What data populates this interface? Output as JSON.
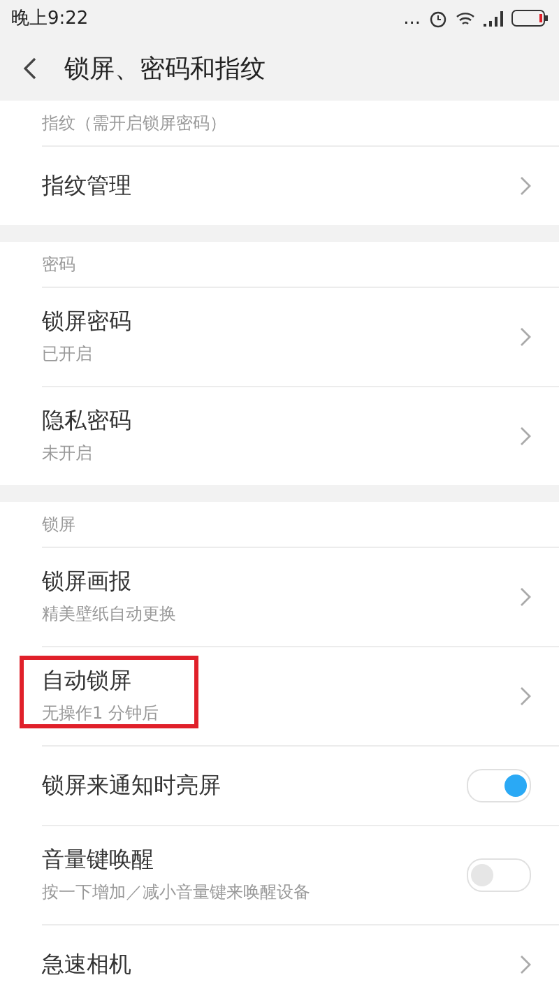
{
  "status_bar": {
    "time": "晚上9:22",
    "dots": "..."
  },
  "header": {
    "title": "锁屏、密码和指纹"
  },
  "sections": [
    {
      "title": "指纹（需开启锁屏密码）",
      "items": [
        {
          "kind": "link",
          "title": "指纹管理"
        }
      ]
    },
    {
      "title": "密码",
      "items": [
        {
          "kind": "link",
          "title": "锁屏密码",
          "subtitle": "已开启"
        },
        {
          "kind": "link",
          "title": "隐私密码",
          "subtitle": "未开启"
        }
      ]
    },
    {
      "title": "锁屏",
      "items": [
        {
          "kind": "link",
          "title": "锁屏画报",
          "subtitle": "精美壁纸自动更换"
        },
        {
          "kind": "link",
          "title": "自动锁屏",
          "subtitle": "无操作1 分钟后",
          "highlighted": true
        },
        {
          "kind": "switch",
          "title": "锁屏来通知时亮屏",
          "on": true
        },
        {
          "kind": "switch",
          "title": "音量键唤醒",
          "subtitle": "按一下增加／减小音量键来唤醒设备",
          "on": false
        },
        {
          "kind": "link",
          "title": "急速相机"
        }
      ]
    }
  ]
}
